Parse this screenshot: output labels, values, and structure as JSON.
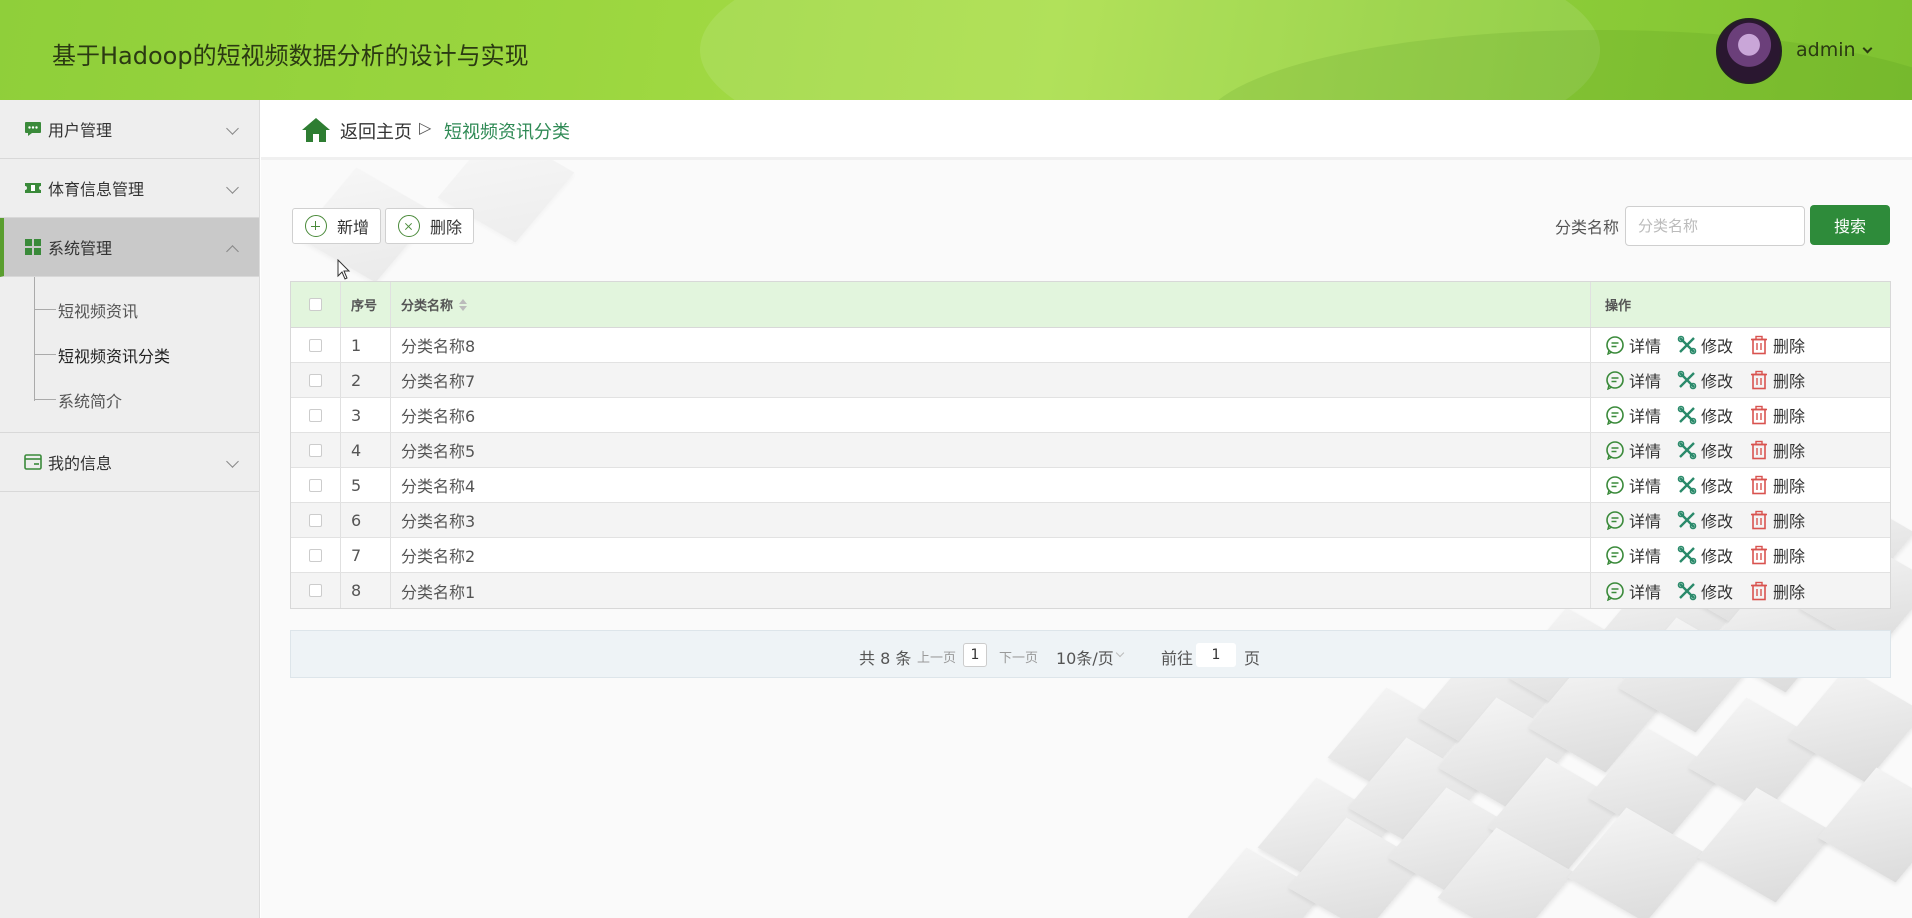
{
  "header": {
    "title": "基于Hadoop的短视频数据分析的设计与实现",
    "username": "admin"
  },
  "sidebar": {
    "items": [
      {
        "label": "用户管理",
        "icon": "chat-icon"
      },
      {
        "label": "体育信息管理",
        "icon": "ticket-icon"
      },
      {
        "label": "系统管理",
        "icon": "grid-icon"
      },
      {
        "label": "我的信息",
        "icon": "card-icon"
      }
    ],
    "submenu": [
      "短视频资讯",
      "短视频资讯分类",
      "系统简介"
    ]
  },
  "breadcrumb": {
    "home": "返回主页",
    "separator": "▷",
    "current": "短视频资讯分类"
  },
  "toolbar": {
    "add_label": "新增",
    "delete_label": "删除"
  },
  "search": {
    "label": "分类名称",
    "placeholder": "分类名称",
    "button": "搜索"
  },
  "table": {
    "headers": {
      "index": "序号",
      "name": "分类名称",
      "ops": "操作"
    },
    "ops": {
      "detail": "详情",
      "edit": "修改",
      "delete": "删除"
    },
    "rows": [
      {
        "index": "1",
        "name": "分类名称8"
      },
      {
        "index": "2",
        "name": "分类名称7"
      },
      {
        "index": "3",
        "name": "分类名称6"
      },
      {
        "index": "4",
        "name": "分类名称5"
      },
      {
        "index": "5",
        "name": "分类名称4"
      },
      {
        "index": "6",
        "name": "分类名称3"
      },
      {
        "index": "7",
        "name": "分类名称2"
      },
      {
        "index": "8",
        "name": "分类名称1"
      }
    ]
  },
  "pagination": {
    "total": "共 8 条",
    "prev": "上一页",
    "page": "1",
    "next": "下一页",
    "page_size": "10条/页",
    "goto_prefix": "前往",
    "goto_value": "1",
    "goto_suffix": "页"
  },
  "colors": {
    "header_green": "#9bd63f",
    "accent_green": "#2e8b3a",
    "table_header_bg": "#e2f5dd",
    "delete_red": "#d9534f"
  }
}
